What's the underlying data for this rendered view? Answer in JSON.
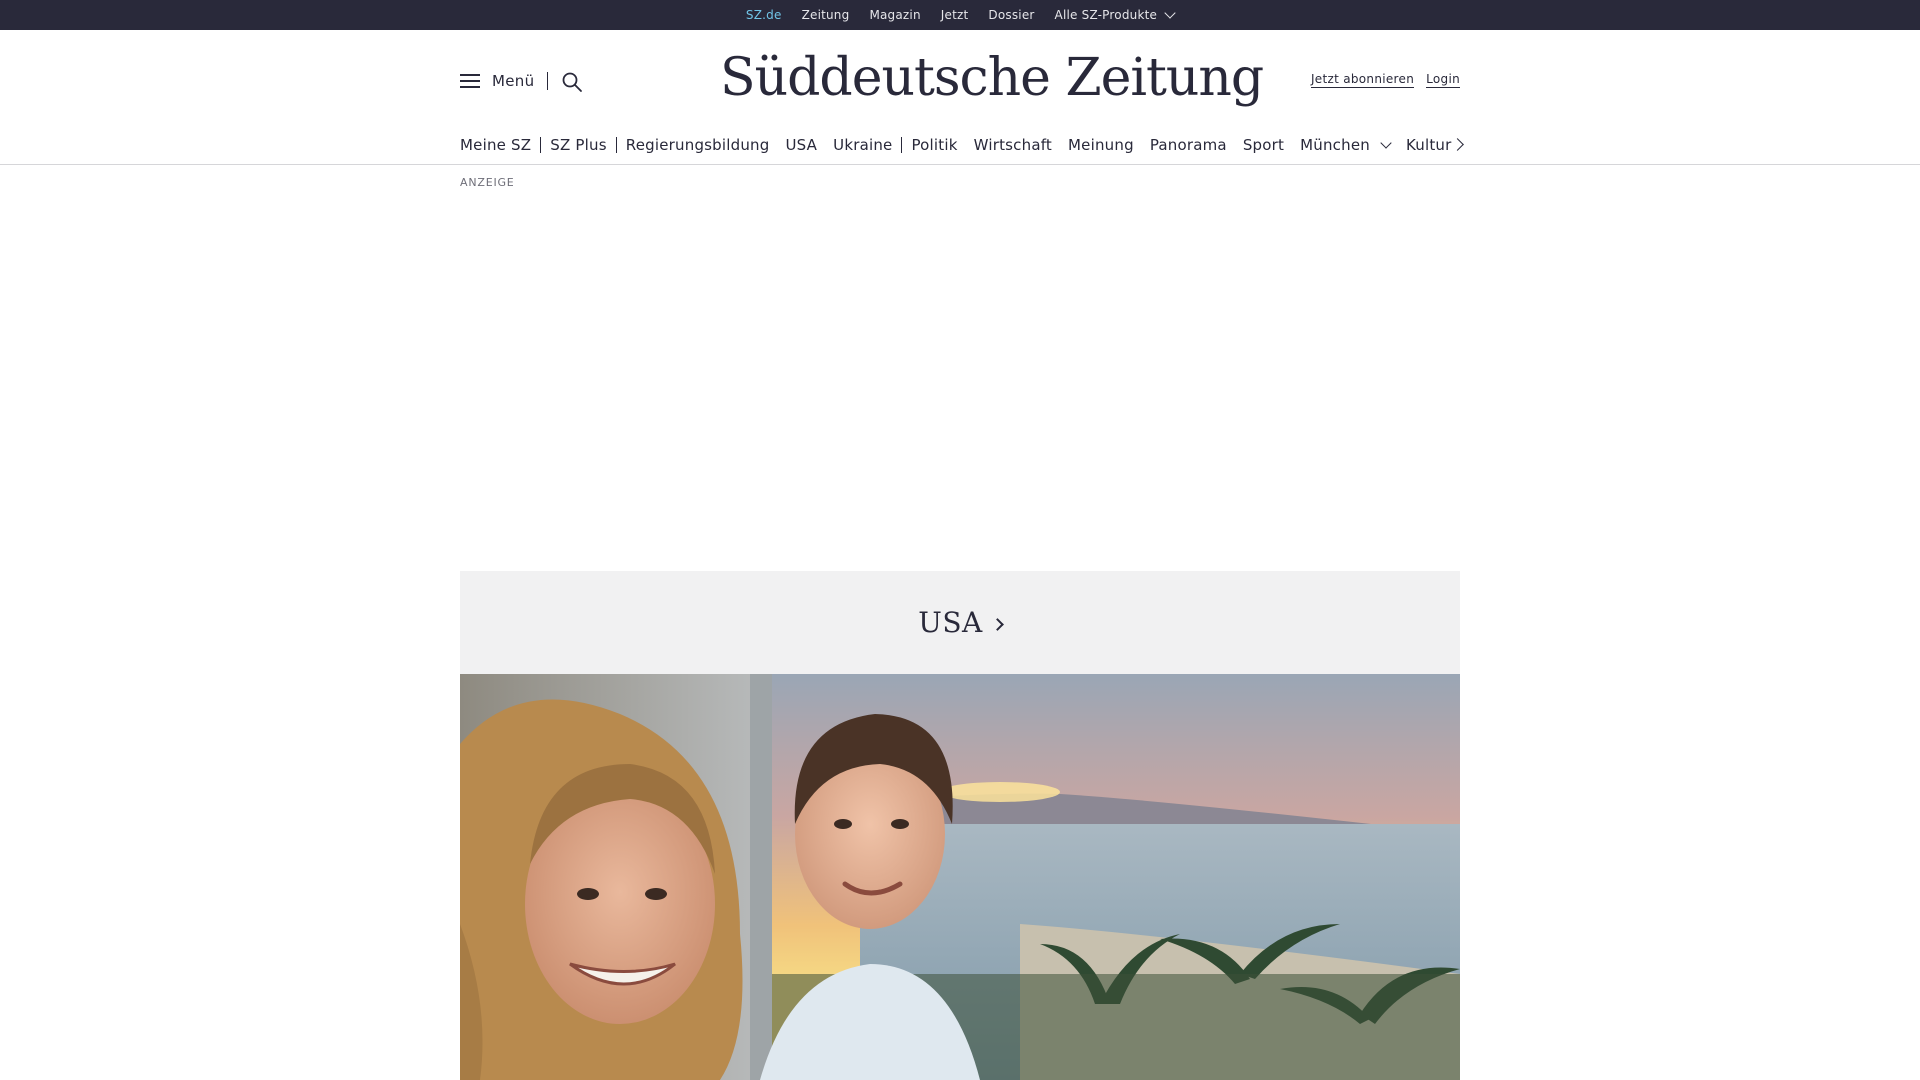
{
  "topbar": {
    "links": [
      "SZ.de",
      "Zeitung",
      "Magazin",
      "Jetzt",
      "Dossier"
    ],
    "products_label": "Alle SZ-Produkte"
  },
  "header": {
    "menu_label": "Menü",
    "logo_text": "Süddeutsche Zeitung",
    "subscribe_label": "Jetzt abonnieren",
    "login_label": "Login"
  },
  "nav": {
    "items": [
      "Meine SZ",
      "SZ Plus",
      "Regierungsbildung",
      "USA",
      "Ukraine",
      "Politik",
      "Wirtschaft",
      "Meinung",
      "Panorama",
      "Sport",
      "München",
      "Kultur"
    ]
  },
  "ad": {
    "label": "ANZEIGE"
  },
  "topic": {
    "title": "USA"
  },
  "colors": {
    "brand_dark": "#29293a",
    "active_link": "#71c5e8",
    "band_background": "#f1f1f2"
  },
  "icons": [
    "hamburger-icon",
    "search-icon",
    "chevron-down-icon",
    "chevron-right-icon"
  ]
}
